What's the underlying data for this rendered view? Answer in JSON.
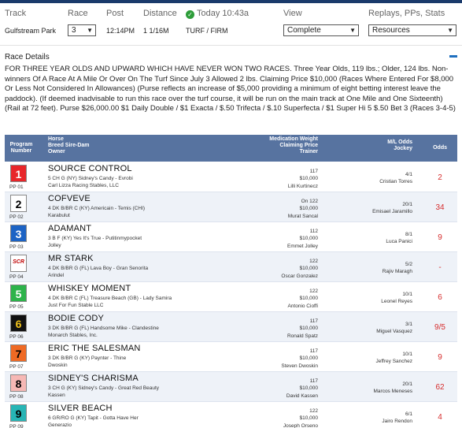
{
  "header": {
    "labels": {
      "track": "Track",
      "race": "Race",
      "post": "Post",
      "distance": "Distance",
      "today": "Today 10:43a",
      "view": "View",
      "replays": "Replays, PPs, Stats"
    },
    "values": {
      "track": "Gulfstream Park",
      "race": "3",
      "post": "12:14PM",
      "distance": "1 1/16M",
      "surface": "TURF / FIRM",
      "view_select": "Complete",
      "replays_select": "Resources"
    }
  },
  "race_details": {
    "title": "Race Details",
    "text": "FOR THREE YEAR OLDS AND UPWARD WHICH HAVE NEVER WON TWO RACES. Three Year Olds, 119 lbs.; Older, 124 lbs. Non-winners Of A Race At A Mile Or Over On The Turf Since July 3 Allowed 2 lbs. Claiming Price $10,000 (Races Where Entered For $8,000 Or Less Not Considered In Allowances) (Purse reflects an increase of $5,000 providing a minimum of eight betting interest leave the paddock). (If deemed inadvisable to run this race over the turf course, it will be run on the main track at One Mile and One Sixteenth) (Rail at 72 feet). Purse $26,000.00 $1 Daily Double / $1 Exacta / $.50 Trifecta / $.10 Superfecta / $1 Super Hi 5 $.50 Bet 3 (Races 3-4-5)"
  },
  "table": {
    "headers": {
      "program": "Program",
      "number": "Number",
      "horse": "Horse",
      "breed": "Breed Sire-Dam",
      "owner": "Owner",
      "med": "Medication Weight",
      "claim": "Claiming Price",
      "trainer": "Trainer",
      "ml": "M/L Odds",
      "jockey": "Jockey",
      "odds": "Odds"
    },
    "rows": [
      {
        "pp": "1",
        "pp_label": "PP 01",
        "bg": "#e8262a",
        "fg": "#ffffff",
        "name": "SOURCE CONTROL",
        "breed": "5 CH G (NY) Sidney's Candy - Evrobi",
        "owner": "Carl Lizza Racing Stables, LLC",
        "med": "117",
        "claim": "$10,000",
        "trainer": "Lilli Kurtinecz",
        "ml": "4/1",
        "jockey": "Cristian Torres",
        "odds": "2"
      },
      {
        "pp": "2",
        "pp_label": "PP 02",
        "bg": "#ffffff",
        "fg": "#000000",
        "name": "COFVEVE",
        "breed": "4 DK B/BR C (KY) Americain - Temis (CHI)",
        "owner": "Karabulut",
        "med": "On 122",
        "claim": "$10,000",
        "trainer": "Murat Sancal",
        "ml": "20/1",
        "jockey": "Emisael Jaramillo",
        "odds": "34"
      },
      {
        "pp": "3",
        "pp_label": "PP 03",
        "bg": "#1c63c4",
        "fg": "#ffffff",
        "name": "ADAMANT",
        "breed": "3 B F (KY) Yes It's True - Putitinmypocket",
        "owner": "Jolley",
        "med": "112",
        "claim": "$10,000",
        "trainer": "Emmet Jolley",
        "ml": "8/1",
        "jockey": "Luca Panici",
        "odds": "9"
      },
      {
        "pp": "SCR",
        "pp_label": "PP 04",
        "bg": "#ffffff",
        "fg": "#c00000",
        "name": "MR STARK",
        "breed": "4 DK B/BR G (FL) Lava Boy - Gran Senorita",
        "owner": "Arindel",
        "med": "122",
        "claim": "$10,000",
        "trainer": "Oscar Gonzalez",
        "ml": "5/2",
        "jockey": "Rajiv Maragh",
        "odds": "-"
      },
      {
        "pp": "5",
        "pp_label": "PP 05",
        "bg": "#2db34a",
        "fg": "#ffffff",
        "name": "WHISKEY MOMENT",
        "breed": "4 DK B/BR C (FL) Treasure Beach (GB) - Lady Samira",
        "owner": "Just For Fun Stable LLC",
        "med": "122",
        "claim": "$10,000",
        "trainer": "Antonio Cioffi",
        "ml": "10/1",
        "jockey": "Leonel Reyes",
        "odds": "6"
      },
      {
        "pp": "6",
        "pp_label": "PP 06",
        "bg": "#111111",
        "fg": "#f2c31b",
        "name": "BODIE CODY",
        "breed": "3 DK B/BR G (FL) Handsome Mike - Clandestine",
        "owner": "Monarch Stables, Inc.",
        "med": "117",
        "claim": "$10,000",
        "trainer": "Ronald Spatz",
        "ml": "3/1",
        "jockey": "Miguel Vasquez",
        "odds": "9/5"
      },
      {
        "pp": "7",
        "pp_label": "PP 07",
        "bg": "#ef6a24",
        "fg": "#000000",
        "name": "ERIC THE SALESMAN",
        "breed": "3 DK B/BR G (KY) Paynter - Thine",
        "owner": "Dwoskin",
        "med": "117",
        "claim": "$10,000",
        "trainer": "Steven Dwoskin",
        "ml": "10/1",
        "jockey": "Jeffrey Sanchez",
        "odds": "9"
      },
      {
        "pp": "8",
        "pp_label": "PP 08",
        "bg": "#f6b8b5",
        "fg": "#000000",
        "name": "SIDNEY'S CHARISMA",
        "breed": "3 CH G (KY) Sidney's Candy - Great Red Beauty",
        "owner": "Kassen",
        "med": "117",
        "claim": "$10,000",
        "trainer": "David Kassen",
        "ml": "20/1",
        "jockey": "Marcos Meneses",
        "odds": "62"
      },
      {
        "pp": "9",
        "pp_label": "PP 09",
        "bg": "#27b5b5",
        "fg": "#000000",
        "name": "SILVER BEACH",
        "breed": "6 GR/RO G (KY) Tapit - Gotta Have Her",
        "owner": "Generazio",
        "med": "122",
        "claim": "$10,000",
        "trainer": "Joseph Orseno",
        "ml": "6/1",
        "jockey": "Jairo Rendon",
        "odds": "4"
      }
    ]
  }
}
